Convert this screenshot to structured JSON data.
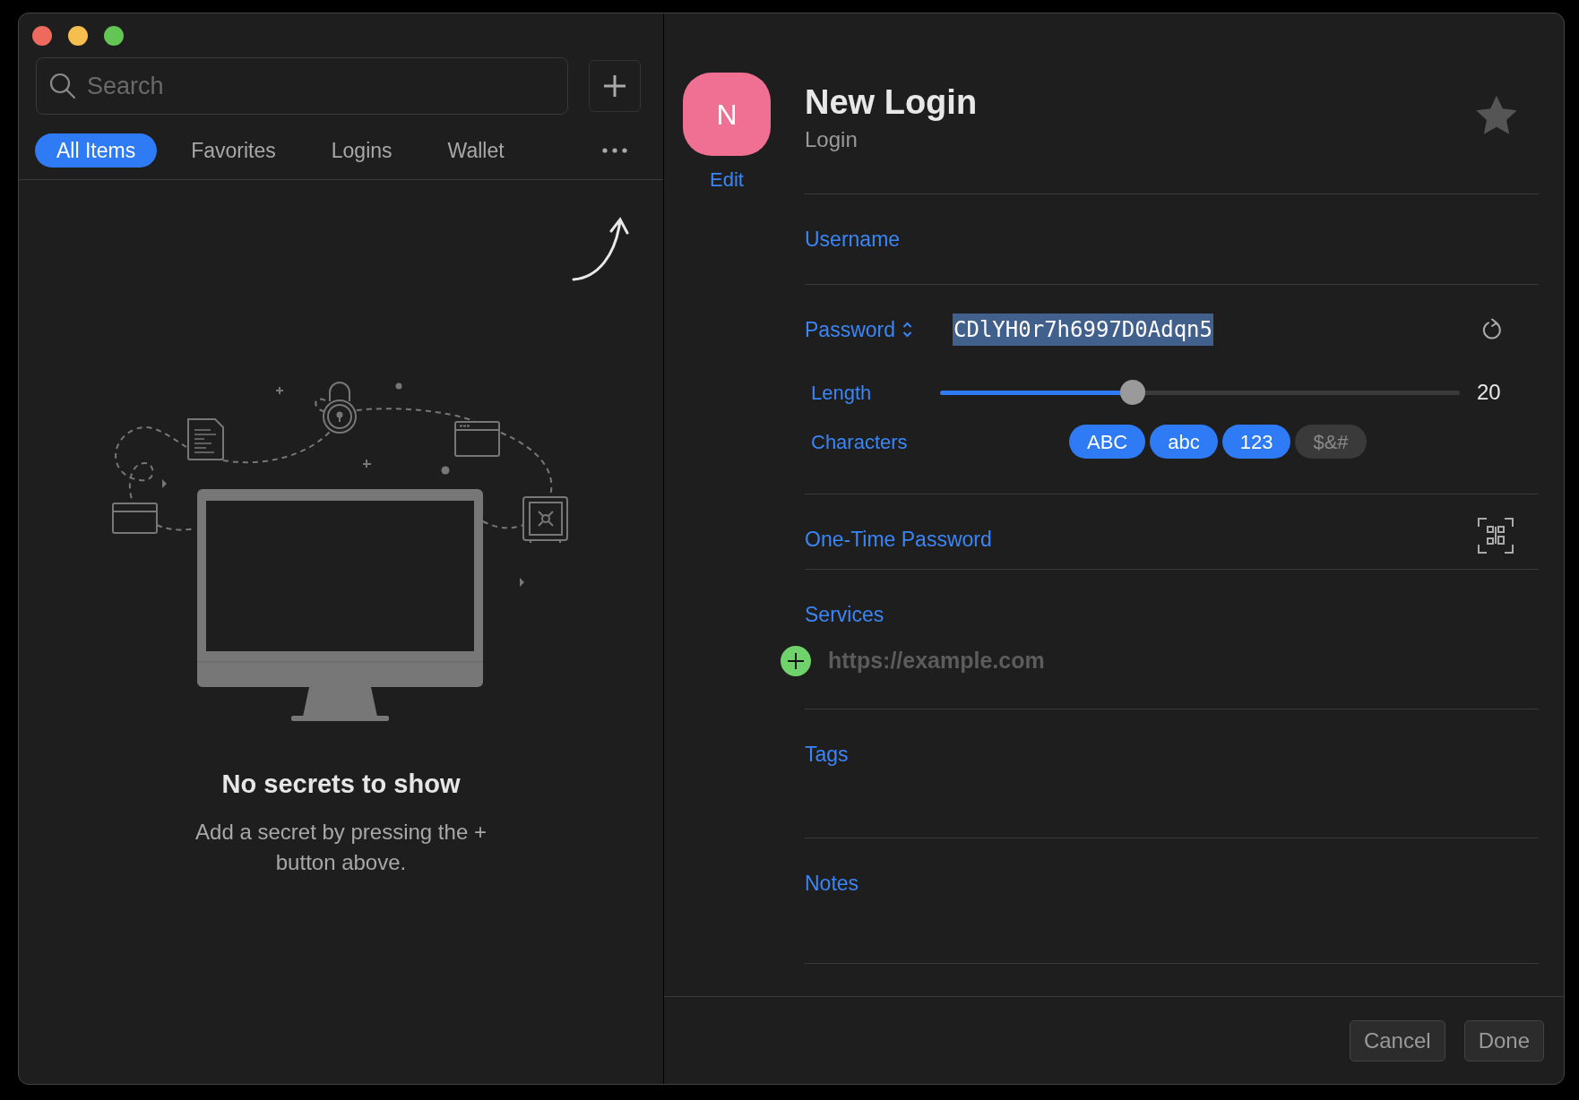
{
  "search": {
    "placeholder": "Search"
  },
  "tabs": [
    {
      "label": "All Items",
      "selected": true
    },
    {
      "label": "Favorites",
      "selected": false
    },
    {
      "label": "Logins",
      "selected": false
    },
    {
      "label": "Wallet",
      "selected": false
    }
  ],
  "empty_state": {
    "title": "No secrets to show",
    "message": "Add a secret by pressing the + button above."
  },
  "item": {
    "avatar_letter": "N",
    "edit_link": "Edit",
    "title": "New Login",
    "subtitle": "Login",
    "favorite": false
  },
  "sections": [
    {
      "kind": "text",
      "label": "Username"
    },
    {
      "kind": "password",
      "label": "Password",
      "value": "CDlYH0r7h6997D0Adqn5",
      "value_selected": true
    },
    {
      "kind": "otp",
      "label": "One-Time Password"
    },
    {
      "kind": "services",
      "label": "Services",
      "placeholder": "https://example.com"
    },
    {
      "kind": "tags",
      "label": "Tags"
    },
    {
      "kind": "notes",
      "label": "Notes"
    }
  ],
  "generator": {
    "length_label": "Length",
    "level": 0.37,
    "length_value": "20",
    "characters_label": "Characters",
    "character_sets": [
      {
        "label": "ABC",
        "selected": true
      },
      {
        "label": "abc",
        "selected": true
      },
      {
        "label": "123",
        "selected": true
      },
      {
        "label": "$&#",
        "selected": false
      }
    ]
  },
  "buttons": [
    {
      "label": "Cancel"
    },
    {
      "label": "Done"
    }
  ]
}
